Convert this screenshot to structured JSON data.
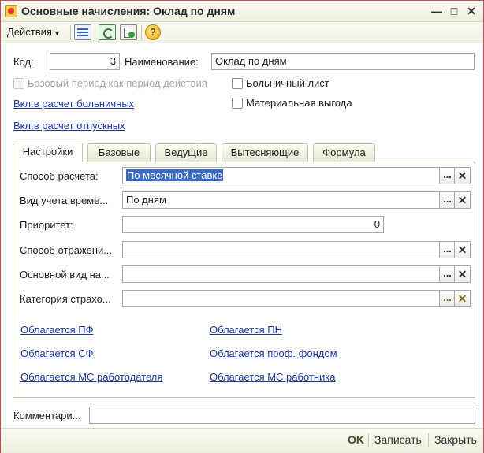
{
  "window": {
    "title": "Основные начисления: Оклад по дням"
  },
  "toolbar": {
    "actions_label": "Действия"
  },
  "form": {
    "code_label": "Код:",
    "code_value": "3",
    "name_label": "Наименование:",
    "name_value": "Оклад по дням",
    "base_period_label": "Базовый период как период действия",
    "sick_list_label": "Больничный лист",
    "material_benefit_label": "Материальная выгода",
    "link_sick": "Вкл.в расчет больничных",
    "link_vacation": "Вкл.в расчет отпускных"
  },
  "tabs": [
    {
      "label": "Настройки"
    },
    {
      "label": "Базовые"
    },
    {
      "label": "Ведущие"
    },
    {
      "label": "Вытесняющие"
    },
    {
      "label": "Формула"
    }
  ],
  "settings": {
    "calc_method_label": "Способ расчета:",
    "calc_method_value": "По месячной ставке",
    "time_type_label": "Вид учета време...",
    "time_type_value": "По дням",
    "priority_label": "Приоритет:",
    "priority_value": "0",
    "reflection_label": "Способ отражени...",
    "reflection_value": "",
    "main_type_label": "Основной вид на...",
    "main_type_value": "",
    "insurance_label": "Категория страхо...",
    "insurance_value": "",
    "tax_links": {
      "pf": "Облагается ПФ",
      "pn": "Облагается ПН",
      "sf": "Облагается СФ",
      "prof": "Облагается проф. фондом",
      "ms_employer": "Облагается МС работодателя",
      "ms_employee": "Облагается МС работника"
    }
  },
  "comment": {
    "label": "Комментари...",
    "value": ""
  },
  "buttons": {
    "ok": "OK",
    "save": "Записать",
    "close": "Закрыть"
  },
  "icons": {
    "app": "app-icon",
    "minimize": "minimize-icon",
    "maximize": "maximize-icon",
    "close": "close-icon",
    "list": "list-icon",
    "refresh": "refresh-icon",
    "copy": "copy-icon",
    "help": "help-icon"
  }
}
